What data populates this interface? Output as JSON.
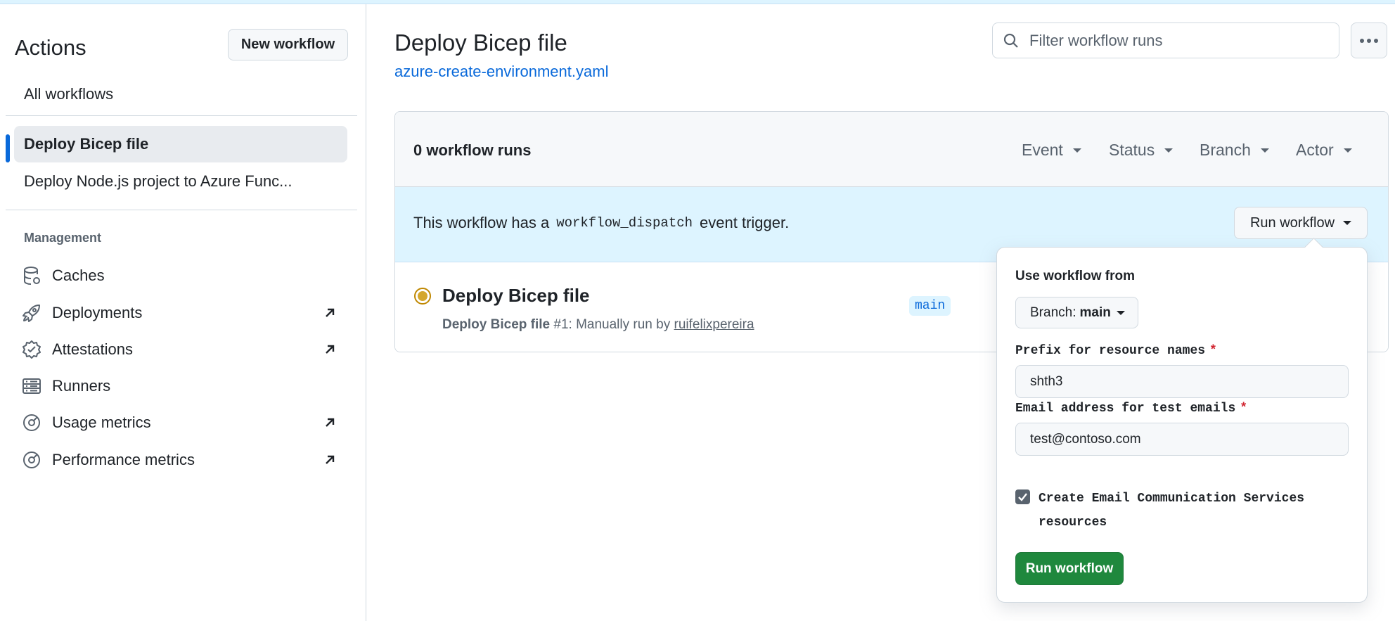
{
  "sidebar": {
    "title": "Actions",
    "new_workflow_label": "New workflow",
    "all_workflows_label": "All workflows",
    "workflows": [
      {
        "label": "Deploy Bicep file",
        "active": true
      },
      {
        "label": "Deploy Node.js project to Azure Func...",
        "active": false
      }
    ],
    "management_label": "Management",
    "management_items": [
      {
        "label": "Caches",
        "icon": "database-icon",
        "external": false
      },
      {
        "label": "Deployments",
        "icon": "rocket-icon",
        "external": true
      },
      {
        "label": "Attestations",
        "icon": "verified-badge-icon",
        "external": true
      },
      {
        "label": "Runners",
        "icon": "server-icon",
        "external": false
      },
      {
        "label": "Usage metrics",
        "icon": "meter-icon",
        "external": true
      },
      {
        "label": "Performance metrics",
        "icon": "meter-icon",
        "external": true
      }
    ]
  },
  "main": {
    "title": "Deploy Bicep file",
    "file_link": "azure-create-environment.yaml",
    "filter_placeholder": "Filter workflow runs",
    "runs_count": "0 workflow runs",
    "filters": [
      "Event",
      "Status",
      "Branch",
      "Actor"
    ],
    "dispatch_prefix": "This workflow has a",
    "dispatch_code": "workflow_dispatch",
    "dispatch_suffix": "event trigger.",
    "run_workflow_label": "Run workflow",
    "run": {
      "title": "Deploy Bicep file",
      "workflow_name": "Deploy Bicep file",
      "meta": "#1: Manually run by",
      "actor": "ruifelixpereira",
      "branch": "main",
      "status": "queued",
      "status_color": "#bf8700"
    }
  },
  "popover": {
    "use_workflow_from_label": "Use workflow from",
    "branch_prefix": "Branch:",
    "branch_value": "main",
    "prefix_label": "Prefix for resource names",
    "prefix_value": "shth3",
    "email_label": "Email address for test emails",
    "email_value": "test@contoso.com",
    "required_marker": "*",
    "checkbox_label": "Create Email Communication Services resources",
    "checkbox_checked": true,
    "submit_label": "Run workflow",
    "submit_color": "#1f883d"
  },
  "colors": {
    "accent": "#0969da",
    "dispatch_bg": "#ddf4ff",
    "muted": "#59636e"
  }
}
